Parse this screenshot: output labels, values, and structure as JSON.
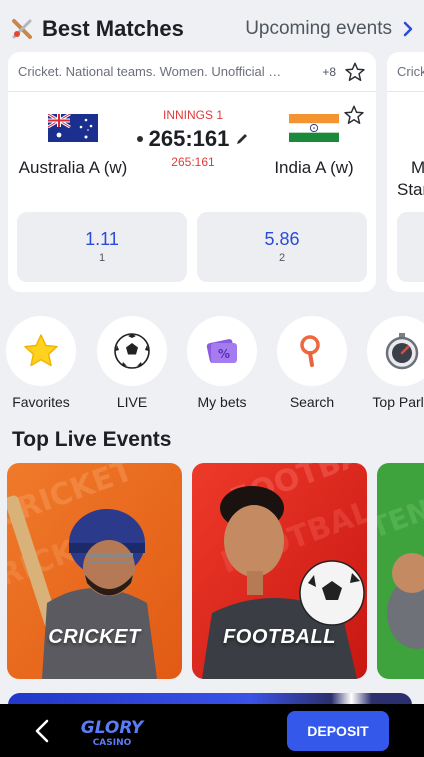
{
  "header": {
    "icon": "cricket-bat-icon",
    "title": "Best Matches",
    "upcoming_label": "Upcoming events"
  },
  "match": {
    "league": "Cricket. National teams. Women. Unofficial …",
    "more_markets": "+8",
    "innings": "INNINGS 1",
    "score": "265:161",
    "score_sub": "265:161",
    "team_a": {
      "name": "Australia A (w)",
      "flag": "australia-flag"
    },
    "team_b": {
      "name": "India A (w)",
      "flag": "india-flag"
    },
    "odds": [
      {
        "value": "1.11",
        "label": "1"
      },
      {
        "value": "5.86",
        "label": "2"
      }
    ]
  },
  "peek_card": {
    "league": "Crick",
    "line1": "M",
    "line2": "Star"
  },
  "quick_actions": [
    {
      "label": "Favorites",
      "icon": "star-icon"
    },
    {
      "label": "LIVE",
      "icon": "soccer-ball-icon"
    },
    {
      "label": "My bets",
      "icon": "bet-ticket-icon"
    },
    {
      "label": "Search",
      "icon": "magnifier-icon"
    },
    {
      "label": "Top Parla",
      "icon": "stopwatch-icon"
    }
  ],
  "live_section": {
    "title": "Top Live Events",
    "events": [
      {
        "label": "CRICKET",
        "color": "#ef6a1c"
      },
      {
        "label": "FOOTBALL",
        "color": "#e0241d"
      },
      {
        "label": "",
        "color": "#3aa33a"
      }
    ]
  },
  "bottom_bar": {
    "logo_top": "GLORY",
    "logo_bottom": "CASINO",
    "deposit_label": "DEPOSIT"
  },
  "colors": {
    "accent": "#3358ea",
    "odds_text": "#2a4bd7",
    "live_red": "#e03a3a",
    "background": "#eef0f4"
  }
}
